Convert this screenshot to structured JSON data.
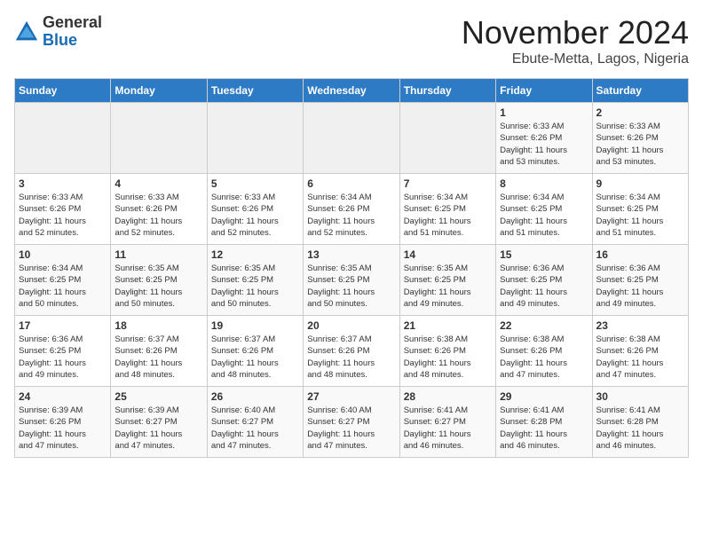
{
  "logo": {
    "general": "General",
    "blue": "Blue"
  },
  "title": "November 2024",
  "subtitle": "Ebute-Metta, Lagos, Nigeria",
  "header_days": [
    "Sunday",
    "Monday",
    "Tuesday",
    "Wednesday",
    "Thursday",
    "Friday",
    "Saturday"
  ],
  "weeks": [
    [
      {
        "day": "",
        "info": ""
      },
      {
        "day": "",
        "info": ""
      },
      {
        "day": "",
        "info": ""
      },
      {
        "day": "",
        "info": ""
      },
      {
        "day": "",
        "info": ""
      },
      {
        "day": "1",
        "info": "Sunrise: 6:33 AM\nSunset: 6:26 PM\nDaylight: 11 hours\nand 53 minutes."
      },
      {
        "day": "2",
        "info": "Sunrise: 6:33 AM\nSunset: 6:26 PM\nDaylight: 11 hours\nand 53 minutes."
      }
    ],
    [
      {
        "day": "3",
        "info": "Sunrise: 6:33 AM\nSunset: 6:26 PM\nDaylight: 11 hours\nand 52 minutes."
      },
      {
        "day": "4",
        "info": "Sunrise: 6:33 AM\nSunset: 6:26 PM\nDaylight: 11 hours\nand 52 minutes."
      },
      {
        "day": "5",
        "info": "Sunrise: 6:33 AM\nSunset: 6:26 PM\nDaylight: 11 hours\nand 52 minutes."
      },
      {
        "day": "6",
        "info": "Sunrise: 6:34 AM\nSunset: 6:26 PM\nDaylight: 11 hours\nand 52 minutes."
      },
      {
        "day": "7",
        "info": "Sunrise: 6:34 AM\nSunset: 6:25 PM\nDaylight: 11 hours\nand 51 minutes."
      },
      {
        "day": "8",
        "info": "Sunrise: 6:34 AM\nSunset: 6:25 PM\nDaylight: 11 hours\nand 51 minutes."
      },
      {
        "day": "9",
        "info": "Sunrise: 6:34 AM\nSunset: 6:25 PM\nDaylight: 11 hours\nand 51 minutes."
      }
    ],
    [
      {
        "day": "10",
        "info": "Sunrise: 6:34 AM\nSunset: 6:25 PM\nDaylight: 11 hours\nand 50 minutes."
      },
      {
        "day": "11",
        "info": "Sunrise: 6:35 AM\nSunset: 6:25 PM\nDaylight: 11 hours\nand 50 minutes."
      },
      {
        "day": "12",
        "info": "Sunrise: 6:35 AM\nSunset: 6:25 PM\nDaylight: 11 hours\nand 50 minutes."
      },
      {
        "day": "13",
        "info": "Sunrise: 6:35 AM\nSunset: 6:25 PM\nDaylight: 11 hours\nand 50 minutes."
      },
      {
        "day": "14",
        "info": "Sunrise: 6:35 AM\nSunset: 6:25 PM\nDaylight: 11 hours\nand 49 minutes."
      },
      {
        "day": "15",
        "info": "Sunrise: 6:36 AM\nSunset: 6:25 PM\nDaylight: 11 hours\nand 49 minutes."
      },
      {
        "day": "16",
        "info": "Sunrise: 6:36 AM\nSunset: 6:25 PM\nDaylight: 11 hours\nand 49 minutes."
      }
    ],
    [
      {
        "day": "17",
        "info": "Sunrise: 6:36 AM\nSunset: 6:25 PM\nDaylight: 11 hours\nand 49 minutes."
      },
      {
        "day": "18",
        "info": "Sunrise: 6:37 AM\nSunset: 6:26 PM\nDaylight: 11 hours\nand 48 minutes."
      },
      {
        "day": "19",
        "info": "Sunrise: 6:37 AM\nSunset: 6:26 PM\nDaylight: 11 hours\nand 48 minutes."
      },
      {
        "day": "20",
        "info": "Sunrise: 6:37 AM\nSunset: 6:26 PM\nDaylight: 11 hours\nand 48 minutes."
      },
      {
        "day": "21",
        "info": "Sunrise: 6:38 AM\nSunset: 6:26 PM\nDaylight: 11 hours\nand 48 minutes."
      },
      {
        "day": "22",
        "info": "Sunrise: 6:38 AM\nSunset: 6:26 PM\nDaylight: 11 hours\nand 47 minutes."
      },
      {
        "day": "23",
        "info": "Sunrise: 6:38 AM\nSunset: 6:26 PM\nDaylight: 11 hours\nand 47 minutes."
      }
    ],
    [
      {
        "day": "24",
        "info": "Sunrise: 6:39 AM\nSunset: 6:26 PM\nDaylight: 11 hours\nand 47 minutes."
      },
      {
        "day": "25",
        "info": "Sunrise: 6:39 AM\nSunset: 6:27 PM\nDaylight: 11 hours\nand 47 minutes."
      },
      {
        "day": "26",
        "info": "Sunrise: 6:40 AM\nSunset: 6:27 PM\nDaylight: 11 hours\nand 47 minutes."
      },
      {
        "day": "27",
        "info": "Sunrise: 6:40 AM\nSunset: 6:27 PM\nDaylight: 11 hours\nand 47 minutes."
      },
      {
        "day": "28",
        "info": "Sunrise: 6:41 AM\nSunset: 6:27 PM\nDaylight: 11 hours\nand 46 minutes."
      },
      {
        "day": "29",
        "info": "Sunrise: 6:41 AM\nSunset: 6:28 PM\nDaylight: 11 hours\nand 46 minutes."
      },
      {
        "day": "30",
        "info": "Sunrise: 6:41 AM\nSunset: 6:28 PM\nDaylight: 11 hours\nand 46 minutes."
      }
    ]
  ]
}
